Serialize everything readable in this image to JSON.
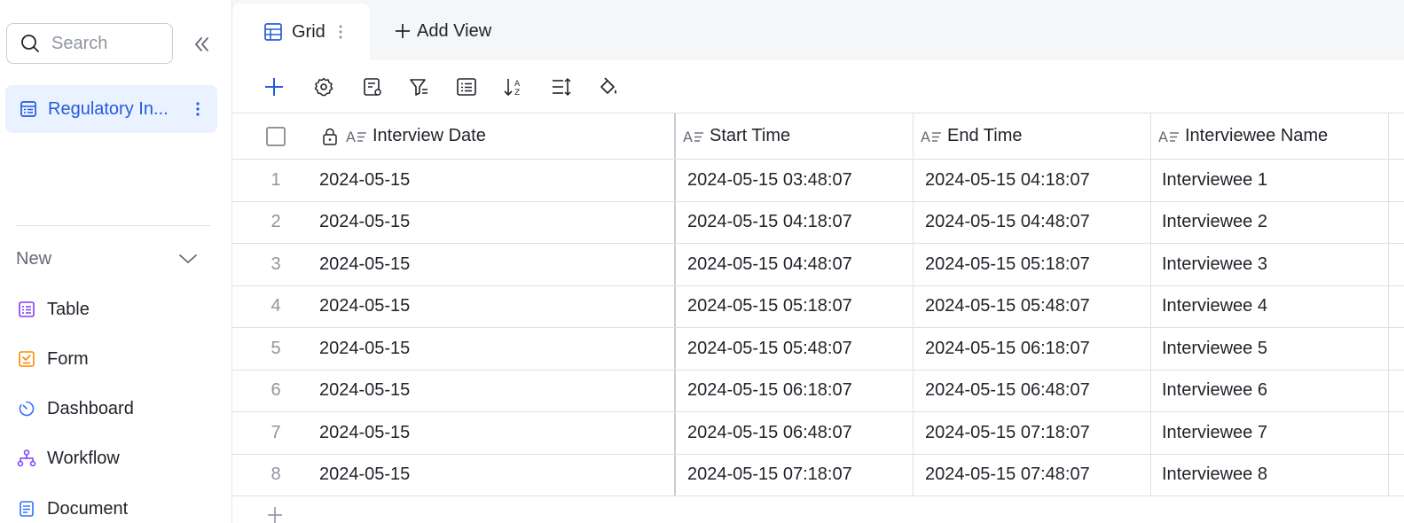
{
  "sidebar": {
    "search_placeholder": "Search",
    "active_item": {
      "label": "Regulatory In...",
      "icon": "table-icon"
    },
    "new_section": {
      "label": "New"
    },
    "create_items": [
      {
        "label": "Table",
        "icon": "table-icon",
        "color": "#7f3bf5"
      },
      {
        "label": "Form",
        "icon": "form-icon",
        "color": "#ff8800"
      },
      {
        "label": "Dashboard",
        "icon": "dashboard-icon",
        "color": "#3370ff"
      },
      {
        "label": "Workflow",
        "icon": "workflow-icon",
        "color": "#7f3bf5"
      },
      {
        "label": "Document",
        "icon": "document-icon",
        "color": "#3370ff"
      }
    ]
  },
  "tabs": {
    "active": {
      "label": "Grid",
      "icon": "grid-icon"
    },
    "add_view_label": "Add View"
  },
  "toolbar": {
    "buttons": [
      "add-record-icon",
      "settings-icon",
      "edit-fields-icon",
      "filter-icon",
      "group-icon",
      "sort-icon",
      "row-height-icon",
      "color-fill-icon"
    ]
  },
  "table": {
    "columns": [
      {
        "name": "Interview Date",
        "locked": true
      },
      {
        "name": "Start Time"
      },
      {
        "name": "End Time"
      },
      {
        "name": "Interviewee Name"
      }
    ],
    "rows": [
      {
        "num": "1",
        "date": "2024-05-15",
        "start": "2024-05-15 03:48:07",
        "end": "2024-05-15 04:18:07",
        "name": "Interviewee 1"
      },
      {
        "num": "2",
        "date": "2024-05-15",
        "start": "2024-05-15 04:18:07",
        "end": "2024-05-15 04:48:07",
        "name": "Interviewee 2"
      },
      {
        "num": "3",
        "date": "2024-05-15",
        "start": "2024-05-15 04:48:07",
        "end": "2024-05-15 05:18:07",
        "name": "Interviewee 3"
      },
      {
        "num": "4",
        "date": "2024-05-15",
        "start": "2024-05-15 05:18:07",
        "end": "2024-05-15 05:48:07",
        "name": "Interviewee 4"
      },
      {
        "num": "5",
        "date": "2024-05-15",
        "start": "2024-05-15 05:48:07",
        "end": "2024-05-15 06:18:07",
        "name": "Interviewee 5"
      },
      {
        "num": "6",
        "date": "2024-05-15",
        "start": "2024-05-15 06:18:07",
        "end": "2024-05-15 06:48:07",
        "name": "Interviewee 6"
      },
      {
        "num": "7",
        "date": "2024-05-15",
        "start": "2024-05-15 06:48:07",
        "end": "2024-05-15 07:18:07",
        "name": "Interviewee 7"
      },
      {
        "num": "8",
        "date": "2024-05-15",
        "start": "2024-05-15 07:18:07",
        "end": "2024-05-15 07:48:07",
        "name": "Interviewee 8"
      }
    ]
  },
  "colors": {
    "accent": "#245bdb",
    "accent_bg": "#eaf1ff",
    "border": "#dee0e3"
  }
}
